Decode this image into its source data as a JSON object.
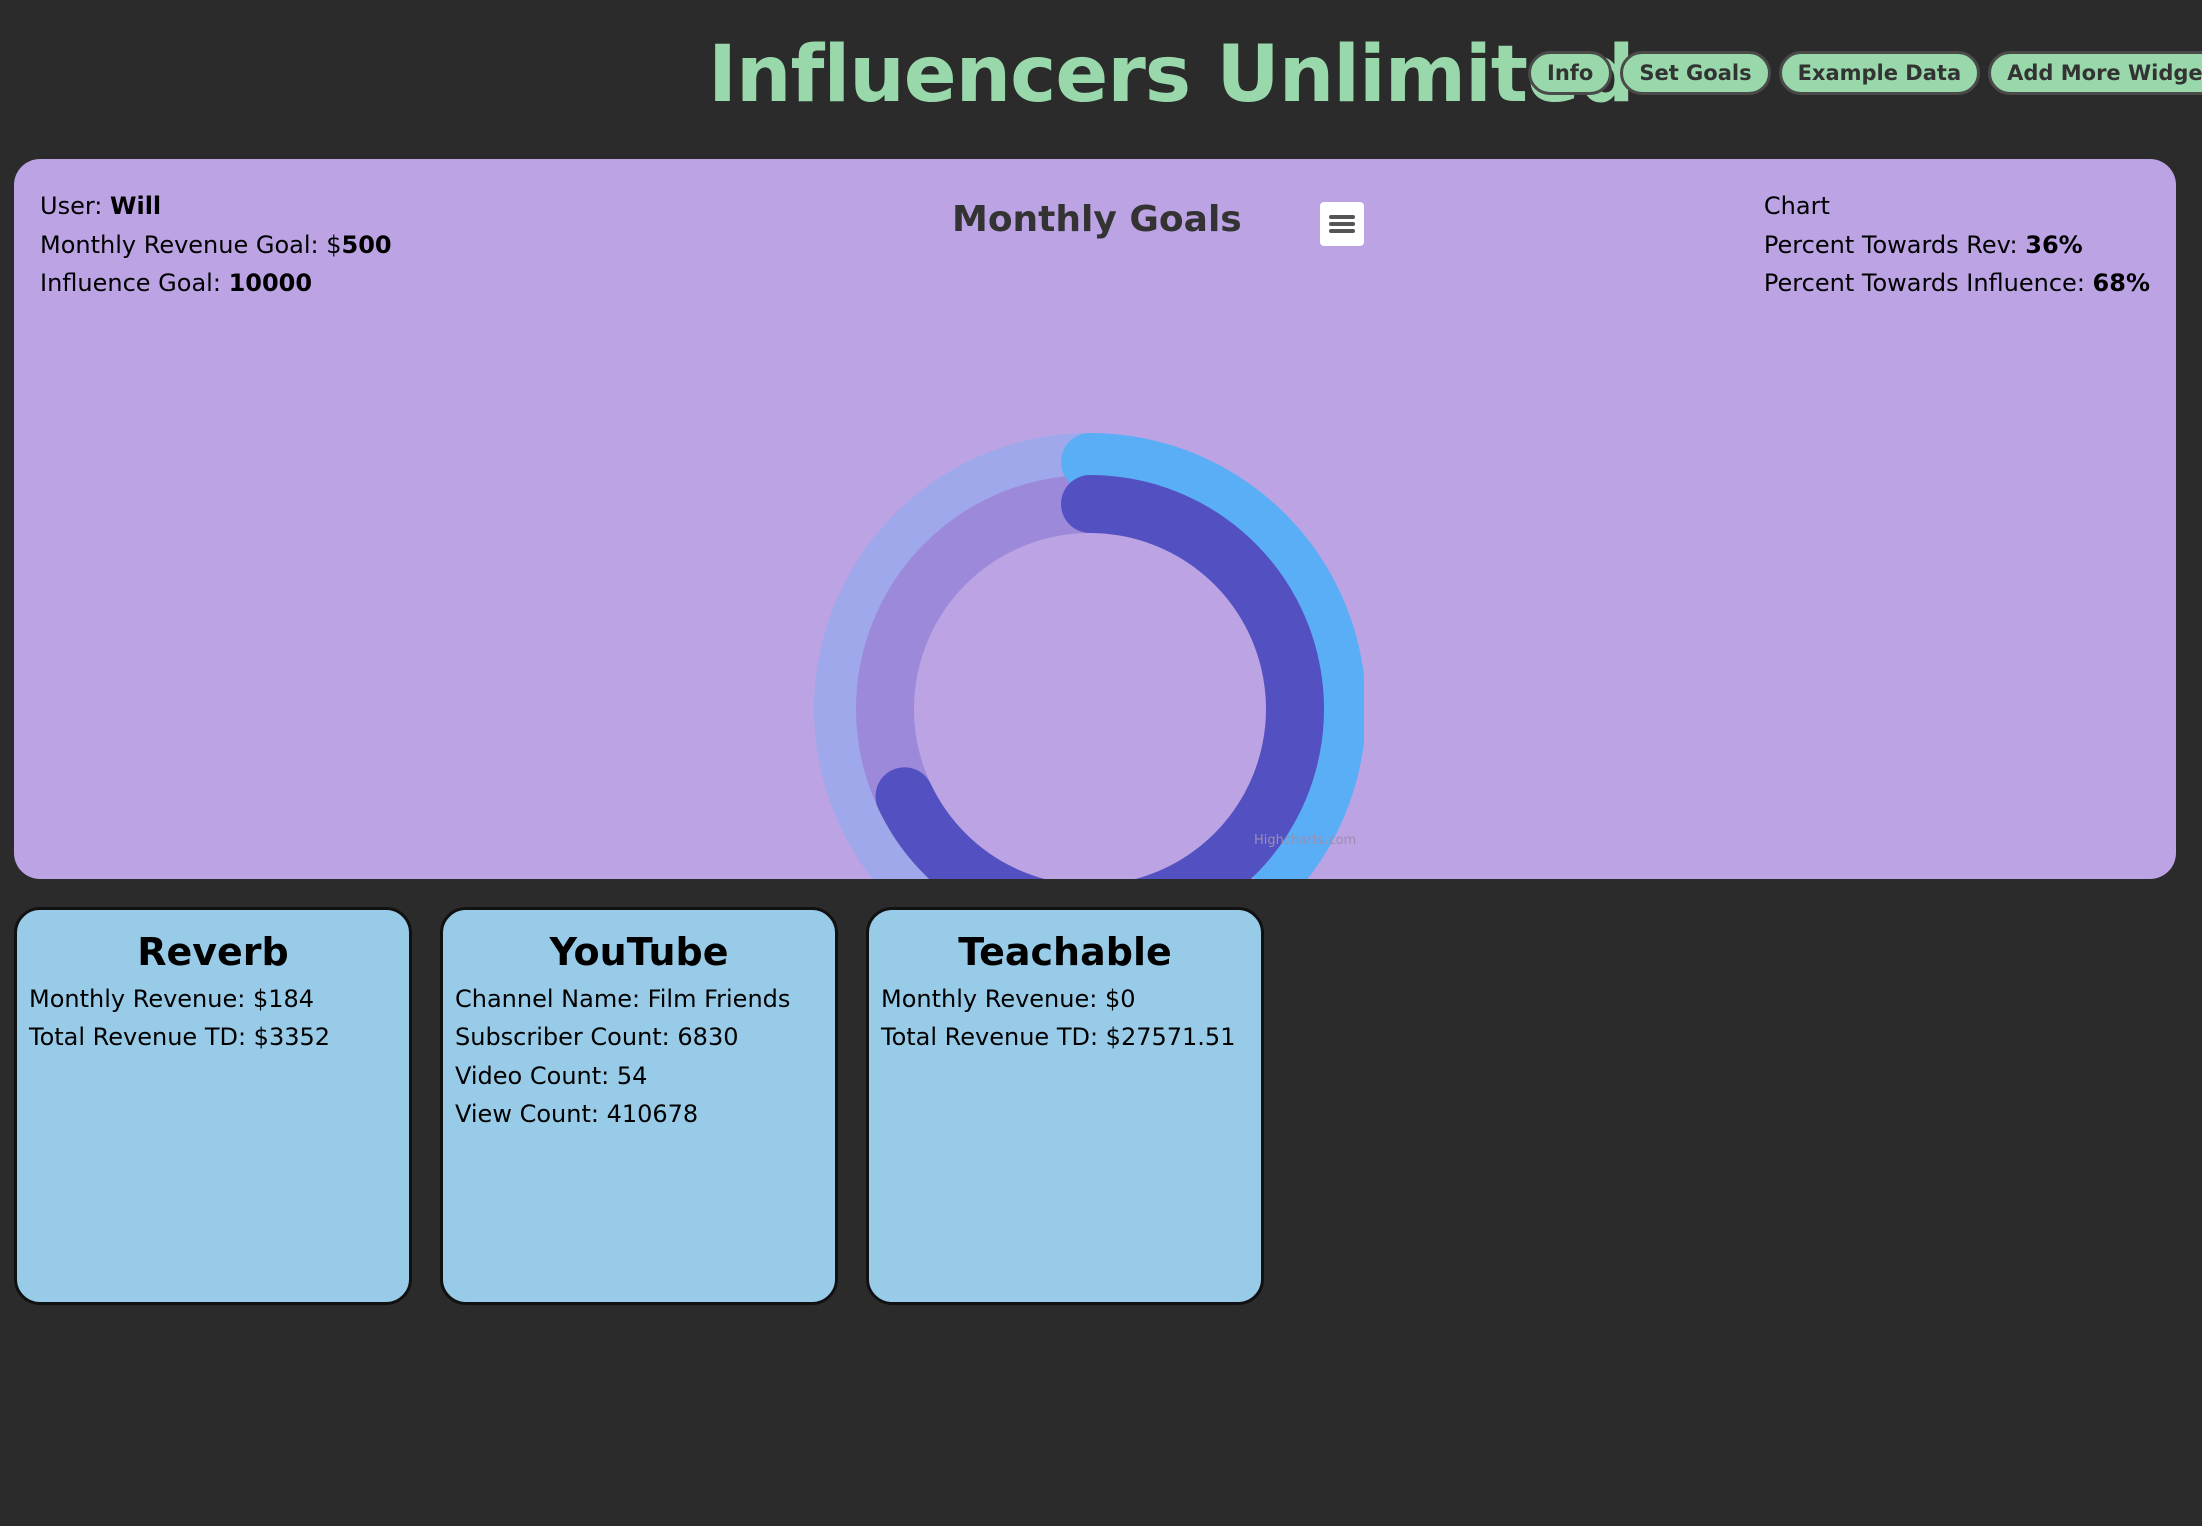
{
  "header": {
    "title": "Influencers Unlimited",
    "buttons": [
      {
        "label": "Info"
      },
      {
        "label": "Set Goals"
      },
      {
        "label": "Example Data"
      },
      {
        "label": "Add More Widgets"
      }
    ]
  },
  "goals": {
    "user_label": "User: ",
    "user_value": "Will",
    "revenue_goal_label": "Monthly Revenue Goal: $",
    "revenue_goal_value": "500",
    "influence_goal_label": "Influence Goal: ",
    "influence_goal_value": "10000",
    "chart_label": "Chart",
    "percent_rev_label": "Percent Towards Rev: ",
    "percent_rev_value": "36%",
    "percent_influence_label": "Percent Towards Influence: ",
    "percent_influence_value": "68%",
    "chart_title": "Monthly Goals",
    "credits": "Highcharts.com",
    "menu_icon": "hamburger-menu-icon"
  },
  "chart_data": {
    "type": "solidgauge",
    "title": "Monthly Goals",
    "max": 100,
    "series": [
      {
        "value": 36,
        "color": "#5aaef6",
        "track_color": "#9ea8ea"
      },
      {
        "value": 68,
        "color": "#5350c1",
        "track_color": "#9d89da"
      }
    ]
  },
  "widgets": [
    {
      "title": "Reverb",
      "lines": [
        "Monthly Revenue: $184",
        "Total Revenue TD: $3352"
      ]
    },
    {
      "title": "YouTube",
      "lines": [
        "Channel Name: Film Friends",
        "Subscriber Count: 6830",
        "Video Count: 54",
        "View Count: 410678"
      ]
    },
    {
      "title": "Teachable",
      "lines": [
        "Monthly Revenue: $0",
        "Total Revenue TD: $27571.51"
      ]
    }
  ]
}
